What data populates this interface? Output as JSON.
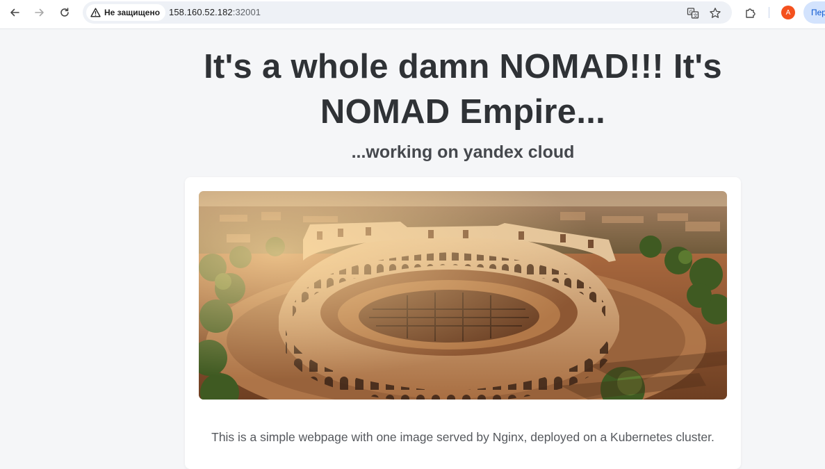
{
  "browser": {
    "security_label": "Не защищено",
    "url_host": "158.160.52.182",
    "url_port": ":32001",
    "profile_initial": "А",
    "profile_button_label": "Пер"
  },
  "page": {
    "headline": "It's a whole damn NOMAD!!! It's NOMAD Empire...",
    "subheadline": "...working on yandex cloud",
    "image_subject": "Colosseum aerial view at sunset",
    "caption": "This is a simple webpage with one image served by Nginx, deployed on a Kubernetes cluster."
  },
  "colors": {
    "page_bg": "#f5f6f8",
    "heading": "#2f3236",
    "avatar": "#f4511e",
    "profile_pill": "#d3e3fd"
  }
}
